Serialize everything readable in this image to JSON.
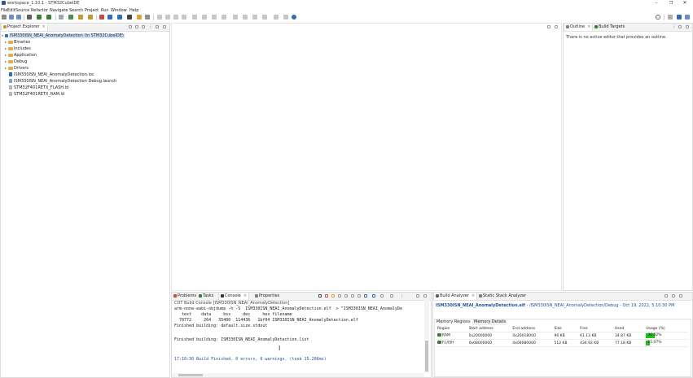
{
  "window": {
    "title": "workspace_1.10.1 - STM32CubeIDE",
    "buttons": [
      "–",
      "❐",
      "✕"
    ]
  },
  "menu": [
    "File",
    "Edit",
    "Source",
    "Refactor",
    "Navigate",
    "Search",
    "Project",
    "Run",
    "Window",
    "Help"
  ],
  "project_explorer": {
    "tab_label": "Project Explorer",
    "root": "ISM330ISN_NEAI_AnomalyDetection (in STM32CubeIDE)",
    "items": [
      {
        "label": "Binaries",
        "kind": "folder"
      },
      {
        "label": "Includes",
        "kind": "folder"
      },
      {
        "label": "Application",
        "kind": "folder"
      },
      {
        "label": "Debug",
        "kind": "folder"
      },
      {
        "label": "Drivers",
        "kind": "folder"
      },
      {
        "label": "ISM330ISN_NEAI_AnomalyDetection.ioc",
        "kind": "file"
      },
      {
        "label": "ISM330ISN_NEAI_AnomalyDetection Debug.launch",
        "kind": "file"
      },
      {
        "label": "STM32F401RETX_FLASH.ld",
        "kind": "file"
      },
      {
        "label": "STM32F401RETX_RAM.ld",
        "kind": "file"
      }
    ]
  },
  "outline": {
    "tab_outline": "Outline",
    "tab_build_targets": "Build Targets",
    "message": "There is no active editor that provides an outline."
  },
  "console": {
    "tabs": [
      "Problems",
      "Tasks",
      "Console",
      "Properties"
    ],
    "header": "CDT Build Console [ISM330ISN_NEAI_AnomalyDetection]",
    "lines": [
      "arm-none-eabi-objdump -h -S  ISM330ISN_NEAI_AnomalyDetection.elf  > \"ISM330ISN_NEAI_AnomalyDe",
      "   text    data     bss     dec     hex filename",
      "  78772     264   35400  114436   1bf04 ISM330ISN_NEAI_AnomalyDetection.elf",
      "Finished building: default.size.stdout",
      "",
      "Finished building: ISM330ISN_NEAI_AnomalyDetection.list",
      "",
      "",
      "17:10:30 Build Finished. 0 errors, 0 warnings. (took 15.206ms)"
    ]
  },
  "build_analyzer": {
    "tabs": [
      "Build Analyzer",
      "Static Stack Analyzer"
    ],
    "title_file": "ISM330ISN_NEAI_AnomalyDetection.elf",
    "title_rest": " - /ISM330ISN_NEAI_AnomalyDetection/Debug - Oct 19, 2022, 5:10:30 PM",
    "subtabs": [
      "Memory Regions",
      "Memory Details"
    ],
    "columns": [
      "Region",
      "Start address",
      "End address",
      "Size",
      "Free",
      "Used",
      "Usage (%)"
    ],
    "rows": [
      {
        "region": "RAM",
        "start": "0x20000000",
        "end": "0x20018000",
        "size": "96 KB",
        "free": "61.13 KB",
        "used": "34.87 KB",
        "usage_text": "36.32%",
        "usage": 36.32
      },
      {
        "region": "FLASH",
        "start": "0x08000000",
        "end": "0x08080000",
        "size": "512 KB",
        "free": "434.92 KB",
        "used": "77.18 KB",
        "usage_text": "15.07%",
        "usage": 15.07
      }
    ]
  },
  "colors": {
    "usage_fill": "#1ec01e",
    "selection": "#cfe3fb",
    "link_blue": "#1f4f9e"
  }
}
